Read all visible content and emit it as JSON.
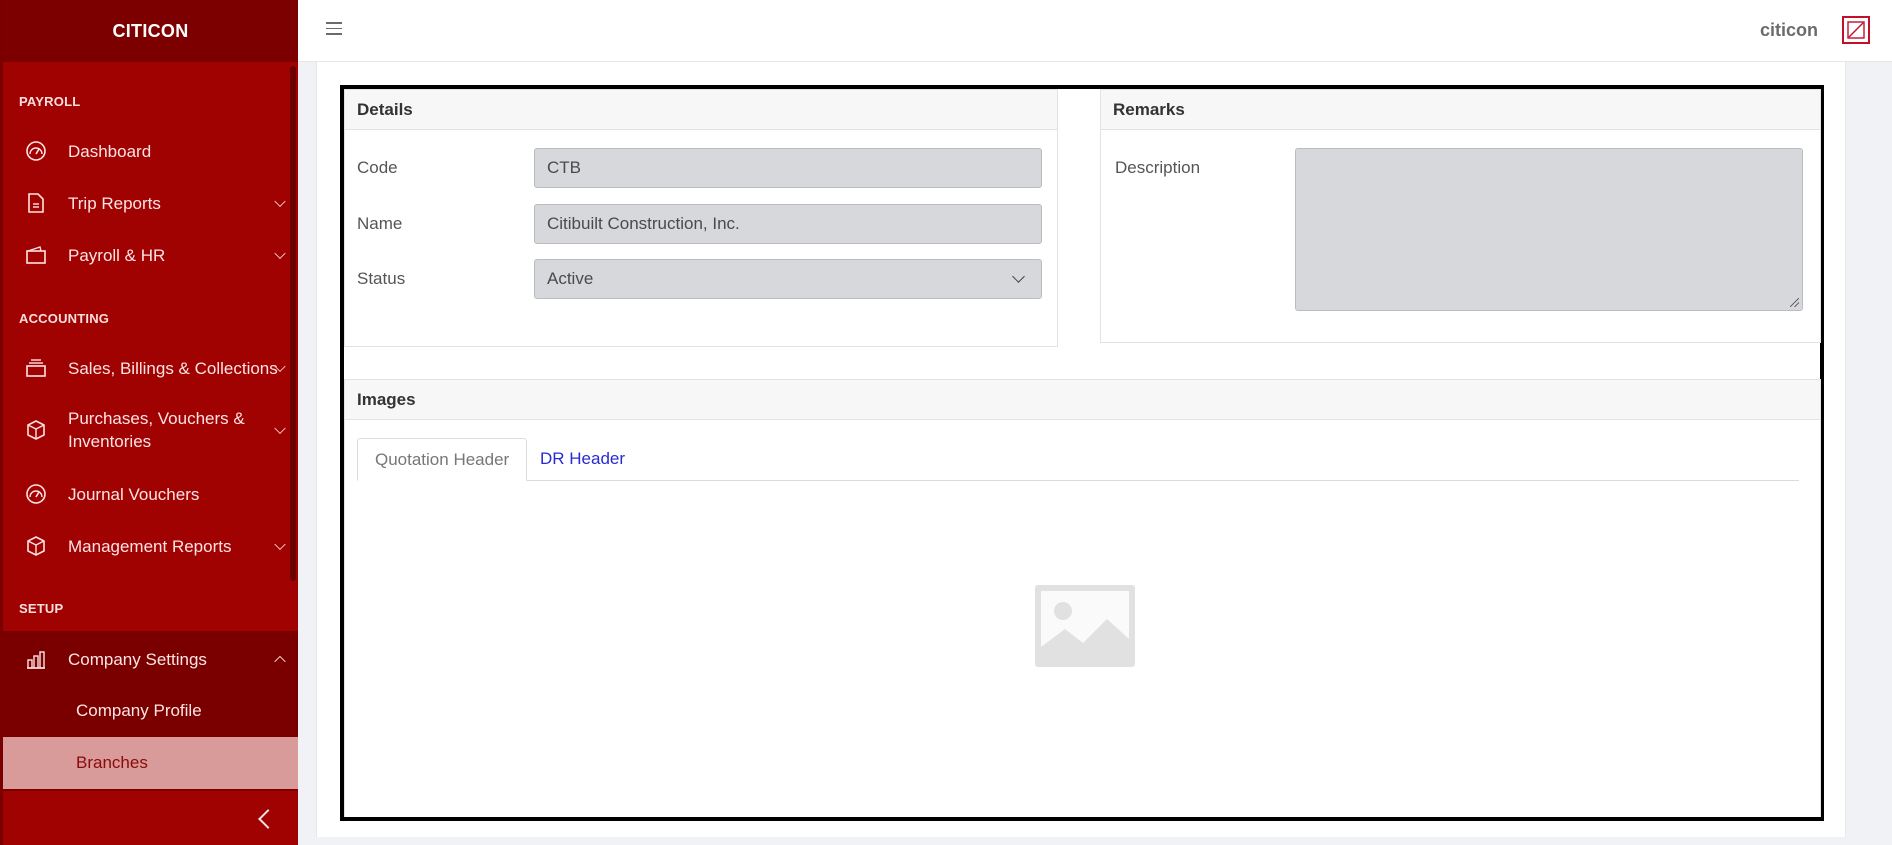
{
  "app": {
    "brand": "CITICON"
  },
  "sidebar": {
    "sections": [
      {
        "title": "PAYROLL"
      },
      {
        "title": "ACCOUNTING"
      },
      {
        "title": "SETUP"
      }
    ],
    "items": [
      {
        "label": "Dashboard",
        "icon": "dashboard-gauge-icon"
      },
      {
        "label": "Trip Reports",
        "icon": "document-icon"
      },
      {
        "label": "Payroll & HR",
        "icon": "wallet-icon"
      },
      {
        "label": "Sales, Billings & Collections",
        "icon": "stack-icon"
      },
      {
        "label": "Purchases, Vouchers & Inventories",
        "icon": "box-icon"
      },
      {
        "label": "Journal Vouchers",
        "icon": "dashboard-gauge-icon"
      },
      {
        "label": "Management Reports",
        "icon": "box-icon"
      },
      {
        "label": "Company Settings",
        "icon": "building-chart-icon"
      }
    ],
    "sub_items": [
      {
        "label": "Company Profile"
      },
      {
        "label": "Branches",
        "active": true
      }
    ]
  },
  "topbar": {
    "user_name": "citicon"
  },
  "details": {
    "title": "Details",
    "fields": {
      "code": {
        "label": "Code",
        "value": "CTB"
      },
      "name": {
        "label": "Name",
        "value": "Citibuilt Construction, Inc."
      },
      "status": {
        "label": "Status",
        "value": "Active"
      }
    }
  },
  "remarks": {
    "title": "Remarks",
    "description": {
      "label": "Description",
      "value": ""
    }
  },
  "images": {
    "title": "Images",
    "tabs": [
      {
        "label": "Quotation Header",
        "active": true
      },
      {
        "label": "DR Header",
        "active": false
      }
    ]
  },
  "colors": {
    "sidebar_bg": "#a00202",
    "sidebar_dark": "#7a0000",
    "active_item_bg": "#d99a9a",
    "link": "#2a2ad0"
  }
}
